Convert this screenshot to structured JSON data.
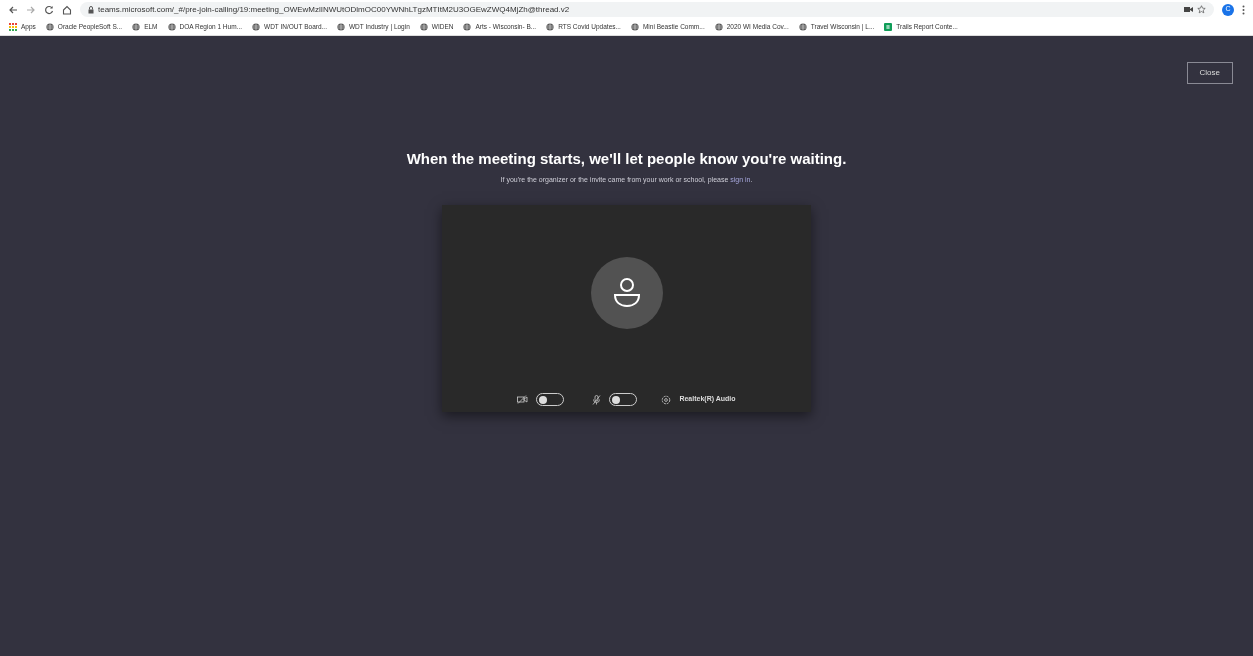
{
  "browser": {
    "url": "teams.microsoft.com/_#/pre-join-calling/19:meeting_OWEwMzlINWUtODlmOC00YWNhLTgzMTItM2U3OGEwZWQ4MjZh@thread.v2",
    "profile_initial": "C",
    "bookmarks": [
      {
        "label": "Apps",
        "kind": "apps"
      },
      {
        "label": "Oracle PeopleSoft S...",
        "kind": "globe"
      },
      {
        "label": "ELM",
        "kind": "globe"
      },
      {
        "label": "DOA Region 1 Hum...",
        "kind": "globe"
      },
      {
        "label": "WDT IN/OUT Board...",
        "kind": "globe"
      },
      {
        "label": "WDT Industry | Login",
        "kind": "globe"
      },
      {
        "label": "WIDEN",
        "kind": "globe"
      },
      {
        "label": "Arts - Wisconsin- B...",
        "kind": "globe"
      },
      {
        "label": "RTS Covid Updates...",
        "kind": "globe"
      },
      {
        "label": "Mini Beastie Comm...",
        "kind": "globe"
      },
      {
        "label": "2020 WI Media Cov...",
        "kind": "globe"
      },
      {
        "label": "Travel Wisconsin | L...",
        "kind": "globe"
      },
      {
        "label": "Trails Report Conte...",
        "kind": "sheet"
      }
    ]
  },
  "close_button": "Close",
  "heading": "When the meeting starts, we'll let people know you're waiting.",
  "subtext": "If you're the organizer or the invite came from your work or school, please",
  "sign_in_link": "sign in",
  "subtext_end": ".",
  "camera": {
    "on": false
  },
  "microphone": {
    "on": false
  },
  "audio_device": "Realtek(R) Audio"
}
